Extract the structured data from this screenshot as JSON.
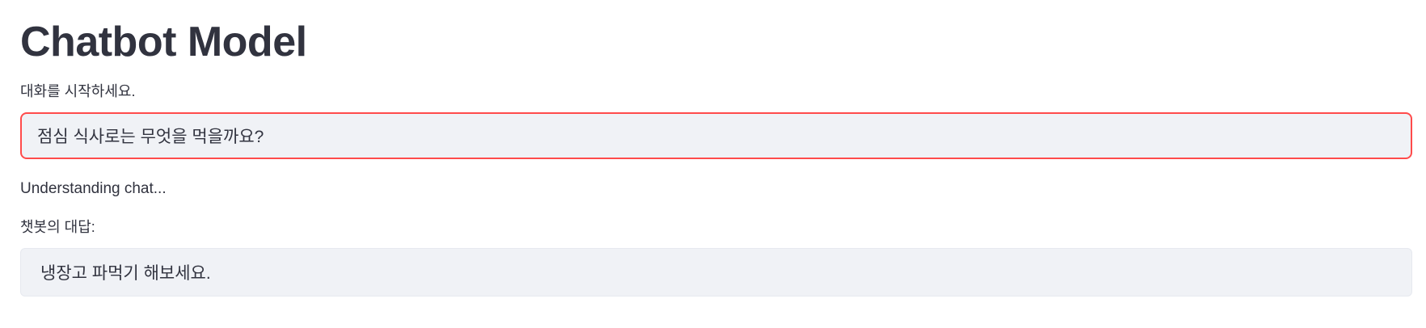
{
  "header": {
    "title": "Chatbot Model"
  },
  "chat_input": {
    "label": "대화를 시작하세요.",
    "value": "점심 식사로는 무엇을 먹을까요?",
    "focus_color": "#ff4b4b"
  },
  "status": {
    "text": "Understanding chat..."
  },
  "response": {
    "label": "챗봇의 대답:",
    "text": "냉장고 파먹기 해보세요."
  }
}
